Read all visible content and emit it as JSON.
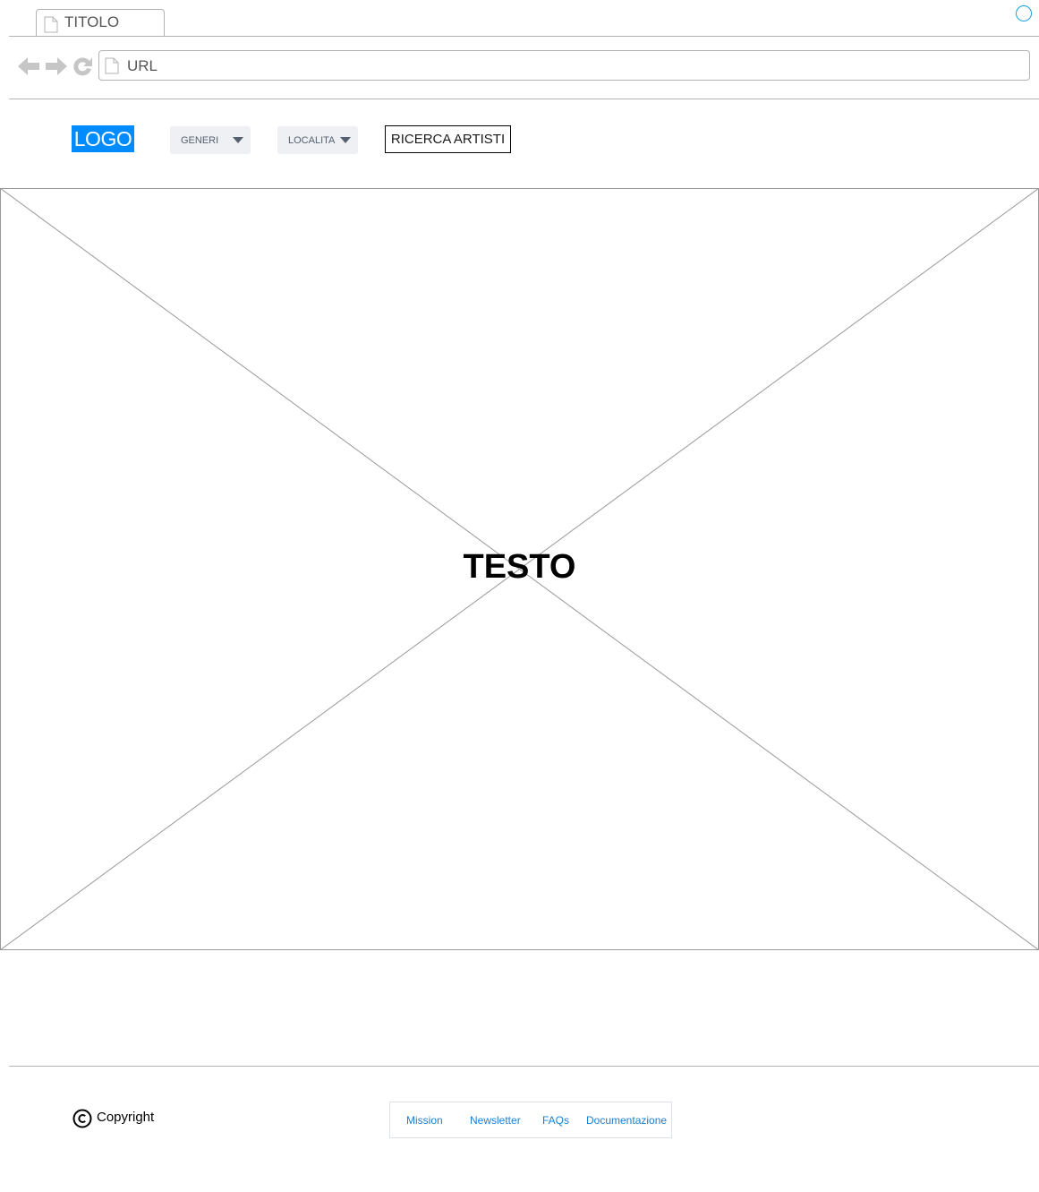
{
  "browser": {
    "tab_title": "TITOLO",
    "url": "URL"
  },
  "header": {
    "logo": "LOGO",
    "dropdowns": [
      {
        "label": "GENERI"
      },
      {
        "label": "LOCALITA"
      }
    ],
    "search_button": "RICERCA ARTISTI"
  },
  "hero": {
    "text": "TESTO"
  },
  "footer": {
    "copyright": "Copyright",
    "links": [
      "Mission",
      "Newsletter",
      "FAQs",
      "Documentazione"
    ]
  },
  "colors": {
    "logo_bg": "#008cff",
    "link": "#1a7fd4",
    "accent_circle": "#1ba1e2"
  }
}
